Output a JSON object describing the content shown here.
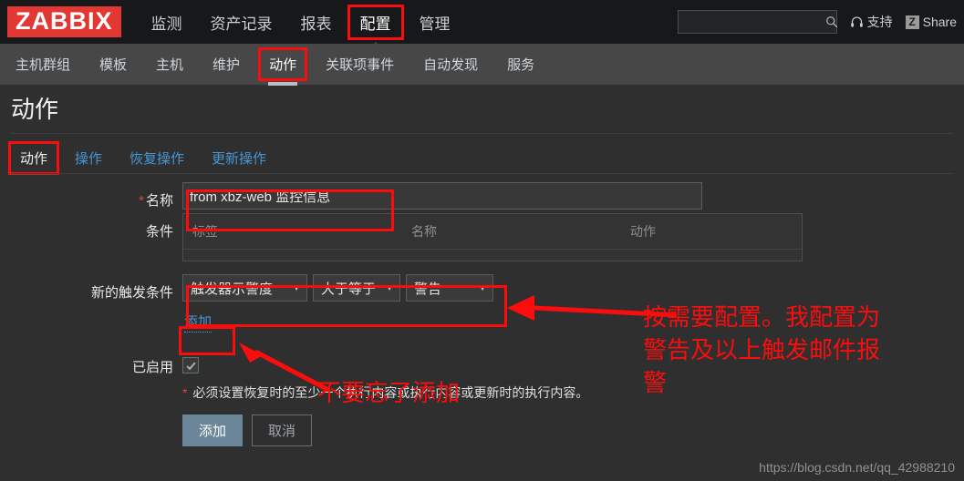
{
  "header": {
    "logo": "ZABBIX",
    "nav": [
      {
        "label": "监测",
        "active": false,
        "boxed": false
      },
      {
        "label": "资产记录",
        "active": false,
        "boxed": false
      },
      {
        "label": "报表",
        "active": false,
        "boxed": false
      },
      {
        "label": "配置",
        "active": true,
        "boxed": true
      },
      {
        "label": "管理",
        "active": false,
        "boxed": false
      }
    ],
    "search_placeholder": "",
    "search_value": "",
    "search_icon": "search-icon",
    "support_label": "支持",
    "support_icon": "headset-icon",
    "share_label": "Share",
    "share_badge": "Z"
  },
  "subnav": [
    {
      "label": "主机群组",
      "active": false,
      "boxed": false
    },
    {
      "label": "模板",
      "active": false,
      "boxed": false
    },
    {
      "label": "主机",
      "active": false,
      "boxed": false
    },
    {
      "label": "维护",
      "active": false,
      "boxed": false
    },
    {
      "label": "动作",
      "active": true,
      "boxed": true
    },
    {
      "label": "关联项事件",
      "active": false,
      "boxed": false
    },
    {
      "label": "自动发现",
      "active": false,
      "boxed": false
    },
    {
      "label": "服务",
      "active": false,
      "boxed": false
    }
  ],
  "page": {
    "title": "动作"
  },
  "tabs": [
    {
      "label": "动作",
      "active": true,
      "boxed": true
    },
    {
      "label": "操作",
      "active": false,
      "boxed": false
    },
    {
      "label": "恢复操作",
      "active": false,
      "boxed": false
    },
    {
      "label": "更新操作",
      "active": false,
      "boxed": false
    }
  ],
  "form": {
    "name": {
      "label": "名称",
      "required": "*",
      "value": "from xbz-web 监控信息",
      "placeholder": ""
    },
    "conditions": {
      "label": "条件",
      "columns": [
        "标签",
        "名称",
        "动作"
      ],
      "rows": []
    },
    "new_condition": {
      "label": "新的触发条件",
      "type_value": "触发器示警度",
      "operator_value": "大于等于",
      "severity_value": "警告",
      "add_link": "添加"
    },
    "enabled": {
      "label": "已启用",
      "checked": true
    },
    "footnote": {
      "required": "*",
      "text": "必须设置恢复时的至少一个执行内容或执行内容或更新时的执行内容。"
    },
    "buttons": {
      "submit": "添加",
      "cancel": "取消"
    }
  },
  "annotations": {
    "note_right": "按需要配置。我配置为\n警告及以上触发邮件报\n警",
    "note_add": "不要忘了添加"
  },
  "watermark": "https://blog.csdn.net/qq_42988210",
  "colors": {
    "accent_red": "#fb0d0d",
    "brand_red": "#e33734",
    "link_blue": "#4796d4",
    "header_bg": "#17181a",
    "subnav_bg": "#474747",
    "page_bg": "#2f2f2f"
  }
}
